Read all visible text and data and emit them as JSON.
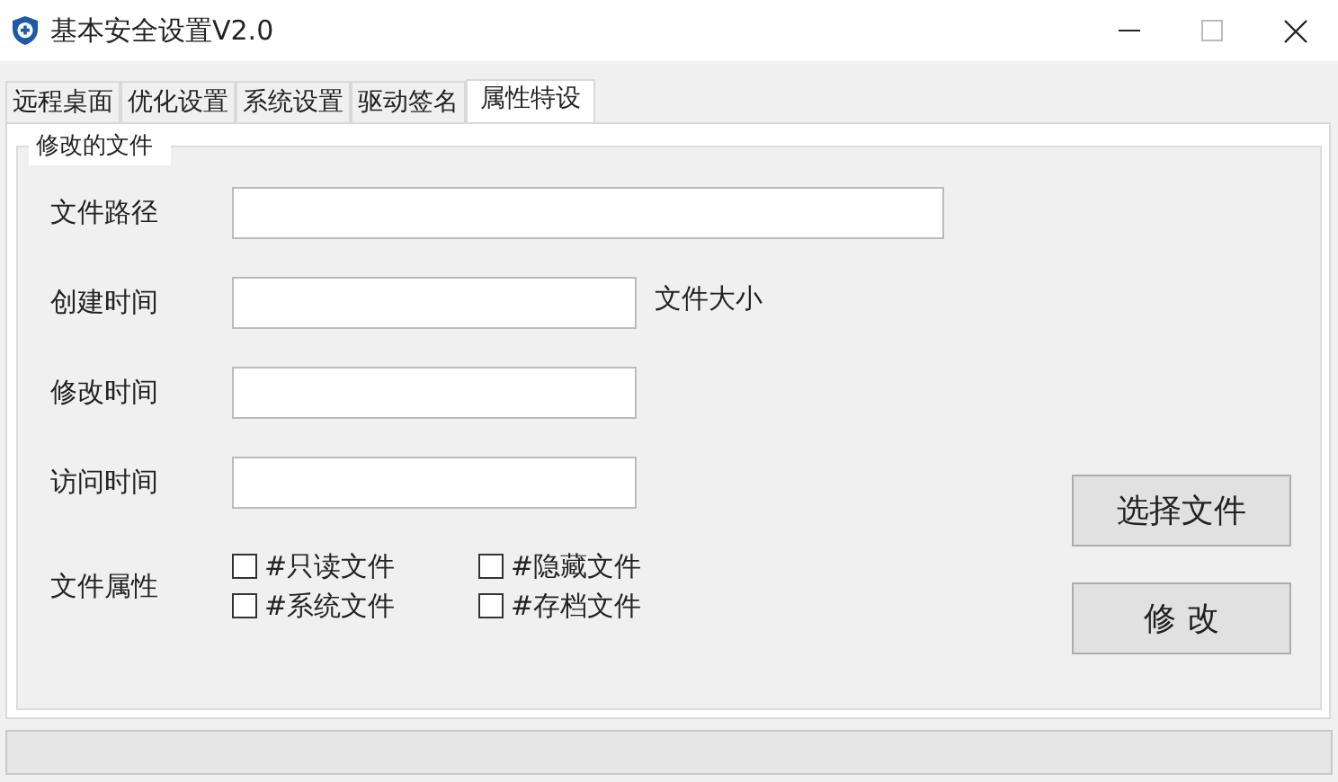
{
  "window": {
    "title": "基本安全设置V2.0"
  },
  "tabs": [
    {
      "label": "远程桌面",
      "selected": false
    },
    {
      "label": "优化设置",
      "selected": false
    },
    {
      "label": "系统设置",
      "selected": false
    },
    {
      "label": "驱动签名",
      "selected": false
    },
    {
      "label": "属性特设",
      "selected": true
    }
  ],
  "group": {
    "legend": "修改的文件"
  },
  "fields": [
    {
      "label": "文件路径",
      "kind": "wide"
    },
    {
      "label": "创建时间",
      "kind": "narrow",
      "side_label": "文件大小"
    },
    {
      "label": "修改时间",
      "kind": "narrow"
    },
    {
      "label": "访问时间",
      "kind": "narrow"
    }
  ],
  "attributes": {
    "label": "文件属性",
    "checkboxes": [
      {
        "label": "#只读文件",
        "checked": false
      },
      {
        "label": "#隐藏文件",
        "checked": false
      },
      {
        "label": "#系统文件",
        "checked": false
      },
      {
        "label": "#存档文件",
        "checked": false
      }
    ]
  },
  "buttons": [
    "选择文件",
    "修 改"
  ]
}
